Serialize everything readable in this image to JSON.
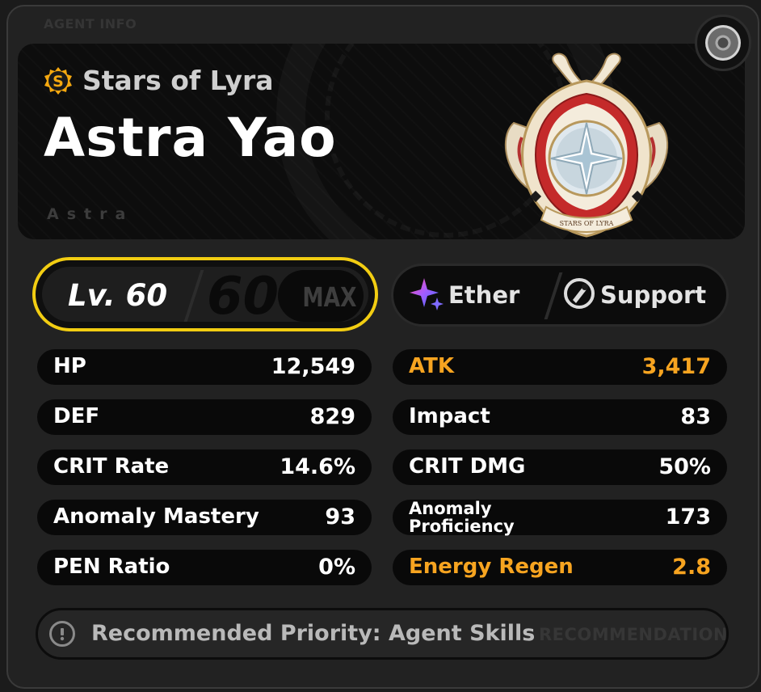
{
  "section_label": "AGENT INFO",
  "faction": {
    "name": "Stars of Lyra",
    "icon": "s-rank-icon",
    "icon_letter": "S"
  },
  "agent": {
    "name": "Astra Yao",
    "subtitle": "Astra"
  },
  "emblem": {
    "caption": "STARS OF LYRA",
    "icon": "stars-of-lyra-emblem"
  },
  "level": {
    "label": "Lv. 60",
    "max_level": "60",
    "max_label": "MAX"
  },
  "types": [
    {
      "label": "Ether",
      "icon": "ether-sparkle-icon"
    },
    {
      "label": "Support",
      "icon": "support-icon"
    }
  ],
  "stats_left": [
    {
      "name": "HP",
      "value": "12,549"
    },
    {
      "name": "DEF",
      "value": "829"
    },
    {
      "name": "CRIT Rate",
      "value": "14.6%"
    },
    {
      "name": "Anomaly Mastery",
      "value": "93"
    },
    {
      "name": "PEN Ratio",
      "value": "0%"
    }
  ],
  "stats_right": [
    {
      "name": "ATK",
      "value": "3,417",
      "highlight": true
    },
    {
      "name": "Impact",
      "value": "83"
    },
    {
      "name": "CRIT DMG",
      "value": "50%"
    },
    {
      "name": "Anomaly Proficiency",
      "name_lines": [
        "Anomaly",
        "Proficiency"
      ],
      "value": "173"
    },
    {
      "name": "Energy Regen",
      "value": "2.8",
      "highlight": true
    }
  ],
  "recommendation": {
    "text": "Recommended Priority: Agent Skills",
    "watermark": "RECOMMENDATION",
    "icon": "info-icon"
  },
  "colors": {
    "accent_yellow": "#f2cd12",
    "highlight_orange": "#f7a420"
  }
}
